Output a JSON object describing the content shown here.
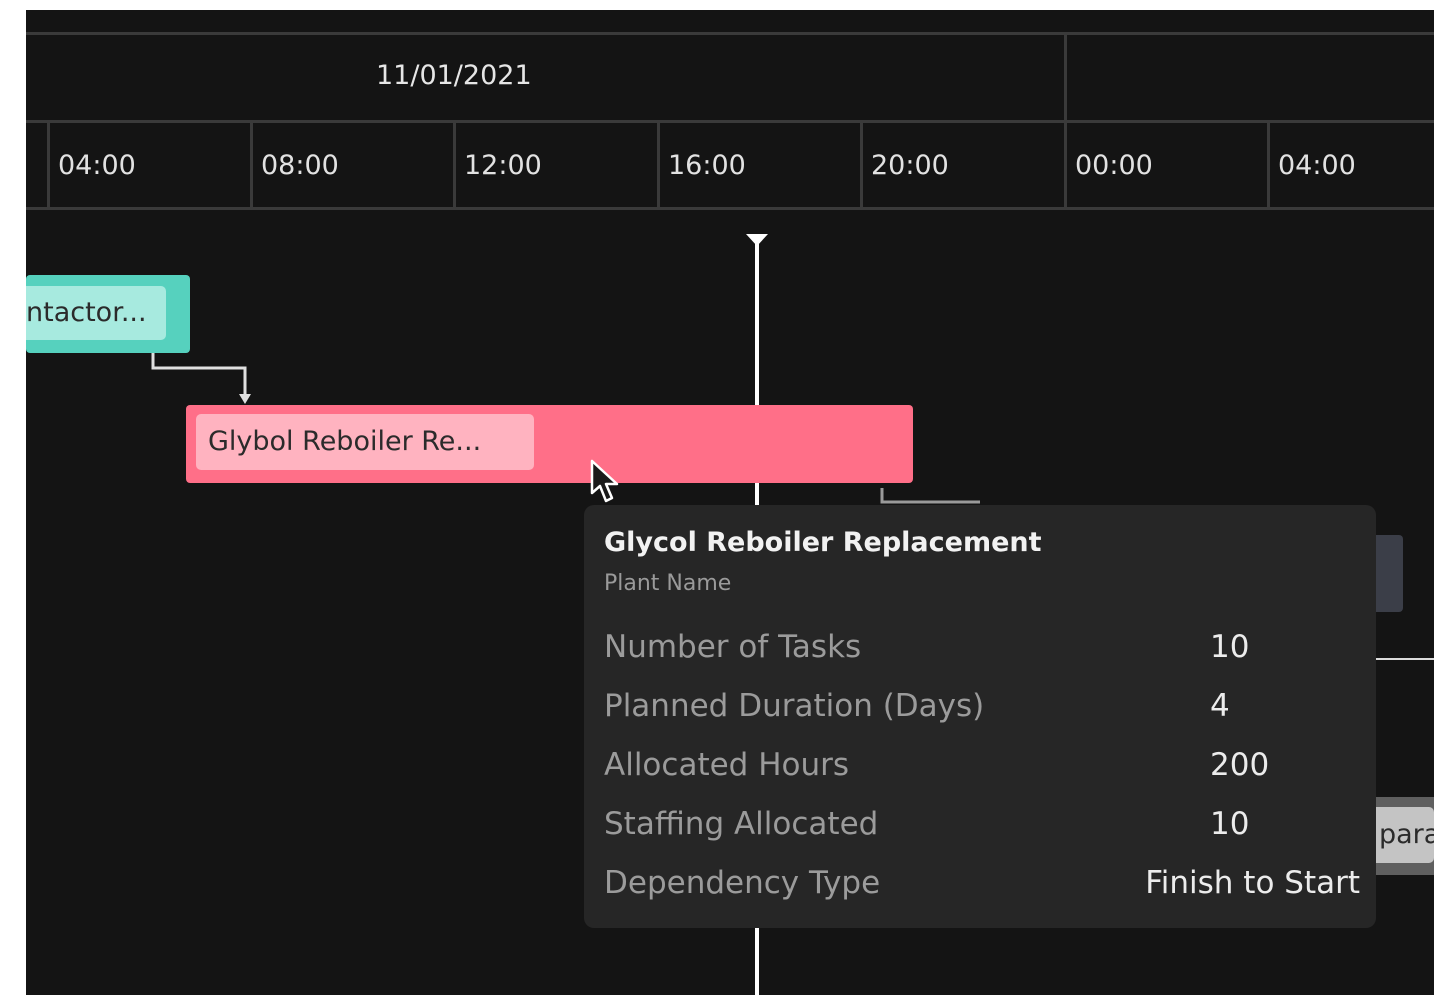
{
  "timeline": {
    "date": "11/01/2021",
    "hours": [
      "04:00",
      "08:00",
      "12:00",
      "16:00",
      "20:00",
      "00:00",
      "04:00"
    ]
  },
  "tasks": {
    "contactor": {
      "label": "ntactor...",
      "color": "#56d1be",
      "label_bg": "#a7eadf"
    },
    "glycol": {
      "label": "Glybol Reboiler Re...",
      "color": "#ff6f88",
      "label_bg": "#ffb3c0"
    },
    "separator": {
      "label": "para"
    }
  },
  "tooltip": {
    "title": "Glycol Reboiler Replacement",
    "subtitle": "Plant Name",
    "rows": [
      {
        "key": "Number of Tasks",
        "value": "10"
      },
      {
        "key": "Planned Duration (Days)",
        "value": "4"
      },
      {
        "key": "Allocated Hours",
        "value": "200"
      },
      {
        "key": "Staffing Allocated",
        "value": "10"
      },
      {
        "key": "Dependency Type",
        "value": "Finish to Start"
      }
    ]
  }
}
